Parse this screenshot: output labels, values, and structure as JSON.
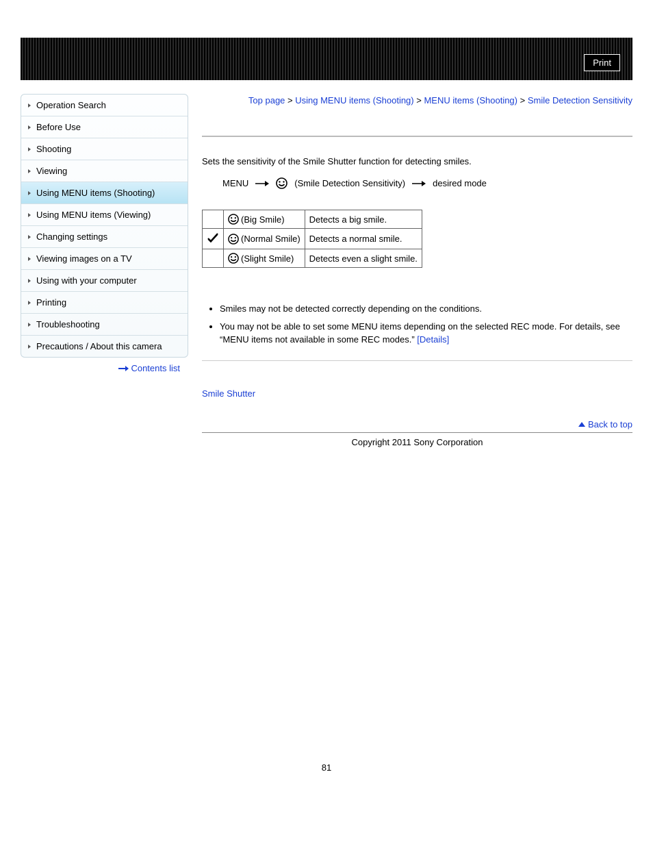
{
  "topbar": {
    "print_label": "Print"
  },
  "sidebar": {
    "items": [
      {
        "label": "Operation Search"
      },
      {
        "label": "Before Use"
      },
      {
        "label": "Shooting"
      },
      {
        "label": "Viewing"
      },
      {
        "label": "Using MENU items (Shooting)"
      },
      {
        "label": "Using MENU items (Viewing)"
      },
      {
        "label": "Changing settings"
      },
      {
        "label": "Viewing images on a TV"
      },
      {
        "label": "Using with your computer"
      },
      {
        "label": "Printing"
      },
      {
        "label": "Troubleshooting"
      },
      {
        "label": "Precautions / About this camera"
      }
    ],
    "contents_list_label": "Contents list"
  },
  "breadcrumb": {
    "top_page": "Top page",
    "sep": " > ",
    "l1": "Using MENU items (Shooting)",
    "l2": "MENU items (Shooting)",
    "current": "Smile Detection Sensitivity"
  },
  "main": {
    "intro": "Sets the sensitivity of the Smile Shutter function for detecting smiles.",
    "menu_label": "MENU",
    "path_label": "(Smile Detection Sensitivity)",
    "desired_mode": "desired mode",
    "table": [
      {
        "checked": false,
        "name": "(Big Smile)",
        "desc": "Detects a big smile."
      },
      {
        "checked": true,
        "name": "(Normal Smile)",
        "desc": "Detects a normal smile."
      },
      {
        "checked": false,
        "name": "(Slight Smile)",
        "desc": "Detects even a slight smile."
      }
    ],
    "notes": [
      "Smiles may not be detected correctly depending on the conditions.",
      "You may not be able to set some MENU items depending on the selected REC mode. For details, see “MENU items not available in some REC modes.” "
    ],
    "details_label": "[Details]",
    "related_link": "Smile Shutter",
    "back_to_top": "Back to top"
  },
  "footer": {
    "copyright": "Copyright 2011 Sony Corporation",
    "page_number": "81"
  }
}
